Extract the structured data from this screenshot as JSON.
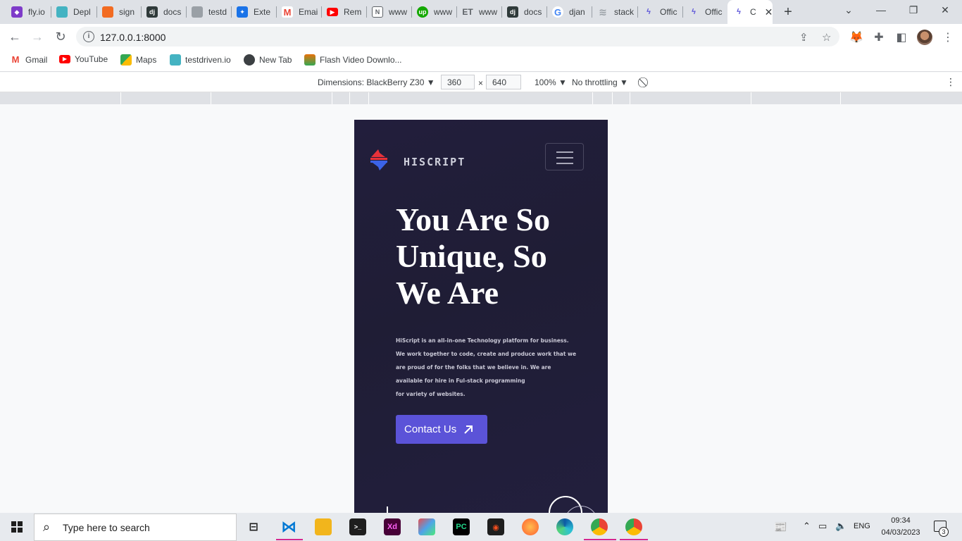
{
  "browser": {
    "tabs": [
      {
        "label": "fly.io",
        "icon": "flyio-icon",
        "color": "#7e3bc9"
      },
      {
        "label": "Depl",
        "icon": "cube-icon",
        "color": "#44b3c2"
      },
      {
        "label": "sign",
        "icon": "box-icon",
        "color": "#f26b21"
      },
      {
        "label": "docs",
        "icon": "django-icon",
        "color": "#2f3a3a"
      },
      {
        "label": "testd",
        "icon": "cube-icon",
        "color": "#9aa0a6"
      },
      {
        "label": "Exte",
        "icon": "puzzle-icon",
        "color": "#1a73e8"
      },
      {
        "label": "Emai",
        "icon": "gmail-icon",
        "color": "#ea4335"
      },
      {
        "label": "Rem",
        "icon": "youtube-icon",
        "color": "#ff0000"
      },
      {
        "label": "www",
        "icon": "n-icon",
        "color": "#5f6368"
      },
      {
        "label": "www",
        "icon": "upwork-icon",
        "color": "#14a800"
      },
      {
        "label": "www",
        "icon": "et-icon",
        "color": "#5f6368"
      },
      {
        "label": "docs",
        "icon": "django-icon",
        "color": "#2f3a3a"
      },
      {
        "label": "djan",
        "icon": "google-icon",
        "color": "#4285f4"
      },
      {
        "label": "stack",
        "icon": "stack-icon",
        "color": "#9aa0a6"
      },
      {
        "label": "Offic",
        "icon": "hiscript-icon",
        "color": "#5b53d8"
      },
      {
        "label": "Offic",
        "icon": "hiscript-icon",
        "color": "#5b53d8"
      },
      {
        "label": "C",
        "icon": "hiscript-icon",
        "color": "#5b53d8"
      }
    ],
    "url": "127.0.0.1:8000",
    "bookmarks": [
      {
        "label": "Gmail",
        "color": "#ea4335"
      },
      {
        "label": "YouTube",
        "color": "#ff0000"
      },
      {
        "label": "Maps",
        "color": "#34a853"
      },
      {
        "label": "testdriven.io",
        "color": "#44b3c2"
      },
      {
        "label": "New Tab",
        "color": "#3c4043"
      },
      {
        "label": "Flash Video Downlo...",
        "color": "#e8710a"
      }
    ]
  },
  "devtools": {
    "dimensions_label": "Dimensions: BlackBerry Z30 ▼",
    "width": "360",
    "times": "×",
    "height": "640",
    "zoom": "100% ▼",
    "throttling": "No throttling ▼"
  },
  "site": {
    "brand": "HISCRIPT",
    "hero_title": "You Are So Unique, So We Are",
    "hero_lines": [
      "HiScript is an all-in-one Technology platform for business.",
      "We work together to code, create and produce work that we",
      "are proud of for the folks that we believe in. We are",
      "available for hire in Ful-stack programming",
      "for variety of websites."
    ],
    "contact_label": "Contact Us",
    "accent": "#5b53d8",
    "background": "#221e3c"
  },
  "taskbar": {
    "search_placeholder": "Type here to search",
    "language": "ENG",
    "time": "09:34",
    "date": "04/03/2023",
    "notifications": "3"
  }
}
